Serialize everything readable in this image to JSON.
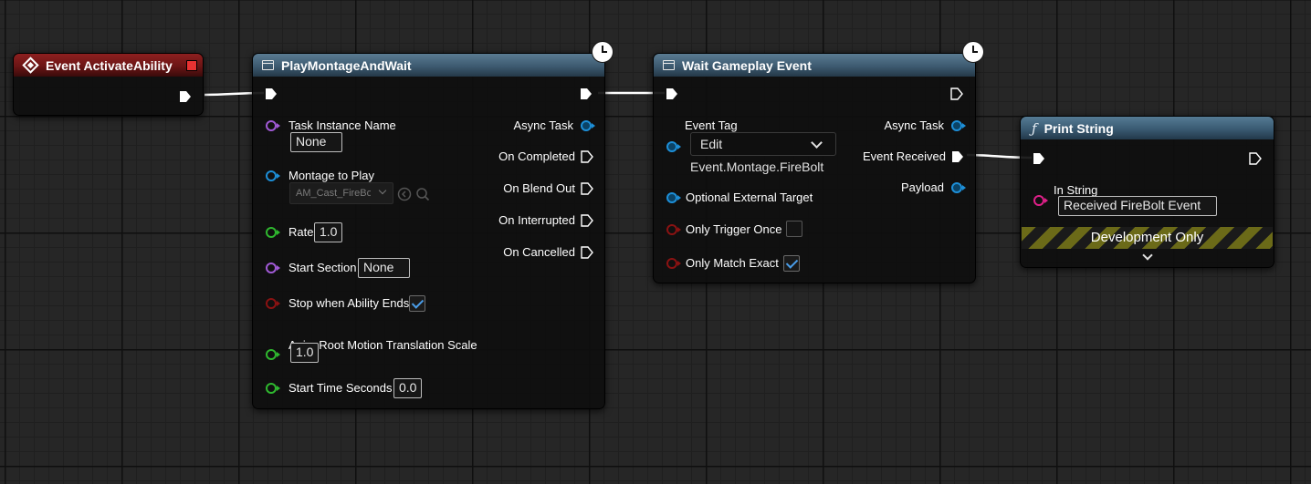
{
  "nodes": {
    "event": {
      "title": "Event ActivateAbility"
    },
    "montage": {
      "title": "PlayMontageAndWait",
      "inputs": {
        "task_instance_name": "Task Instance Name",
        "task_instance_value": "None",
        "montage_to_play": "Montage to Play",
        "montage_value": "AM_Cast_FireBolt",
        "rate": "Rate",
        "rate_value": "1.0",
        "start_section": "Start Section",
        "start_section_value": "None",
        "stop_when_ability_ends": "Stop when Ability Ends",
        "anim_root_motion": "Anim Root Motion Translation Scale",
        "anim_root_motion_value": "1.0",
        "start_time_seconds": "Start Time Seconds",
        "start_time_value": "0.0"
      },
      "outputs": {
        "async_task": "Async Task",
        "on_completed": "On Completed",
        "on_blend_out": "On Blend Out",
        "on_interrupted": "On Interrupted",
        "on_cancelled": "On Cancelled"
      }
    },
    "wait": {
      "title": "Wait Gameplay Event",
      "inputs": {
        "event_tag": "Event Tag",
        "event_tag_dropdown": "Edit",
        "event_tag_value": "Event.Montage.FireBolt",
        "optional_external_target": "Optional External Target",
        "only_trigger_once": "Only Trigger Once",
        "only_match_exact": "Only Match Exact"
      },
      "outputs": {
        "async_task": "Async Task",
        "event_received": "Event Received",
        "payload": "Payload"
      }
    },
    "print": {
      "title": "Print String",
      "in_string": "In String",
      "in_string_value": "Received FireBolt Event",
      "dev_only": "Development Only"
    }
  },
  "state": {
    "stop_when_ability_ends": true,
    "only_trigger_once": false,
    "only_match_exact": true
  },
  "icons": [
    "event-diamond-icon",
    "function-icon",
    "clock-icon",
    "latent-node-icon",
    "chevron-down-icon",
    "browse-icon",
    "search-icon"
  ],
  "colors": {
    "event_header": "#8d1f1f",
    "latent_header": "#3d5a70",
    "exec_wire": "#ffffff",
    "pin_name": "#a15ad6",
    "pin_object": "#1d8fd8",
    "pin_float": "#2fb82f",
    "pin_bool": "#8a1212",
    "pin_string": "#e0208a",
    "checkmark": "#4a9de8"
  }
}
